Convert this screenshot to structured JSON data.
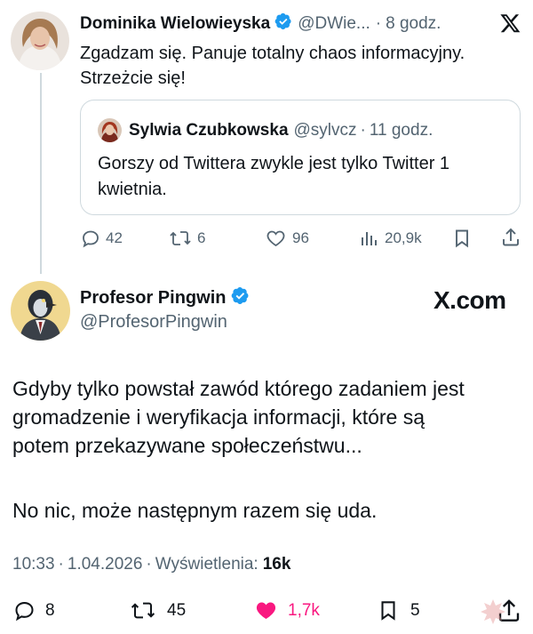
{
  "reply": {
    "name": "Dominika Wielowieyska",
    "handle": "@DWie...",
    "separator": "·",
    "time": "8 godz.",
    "text_line1": "Zgadzam się. Panuje totalny chaos informacyjny.",
    "text_line2": "Strzeżcie się!",
    "quote": {
      "name": "Sylwia Czubkowska",
      "handle": "@sylvcz",
      "separator": "·",
      "time": "11 godz.",
      "text_line1": "Gorszy od Twittera zwykle jest tylko Twitter 1",
      "text_line2": "kwietnia."
    },
    "actions": {
      "replies": "42",
      "reposts": "6",
      "likes": "96",
      "views": "20,9k"
    }
  },
  "main": {
    "name": "Profesor Pingwin",
    "handle": "@ProfesorPingwin",
    "brand": "X.com",
    "text_lines": [
      "Gdyby tylko powstał zawód którego zadaniem jest",
      "gromadzenie i weryfikacja informacji, które są",
      "potem przekazywane społeczeństwu..."
    ],
    "text_line4": "No nic, może następnym razem się uda.",
    "meta": {
      "time": "10:33",
      "sep1": "·",
      "date": "1.04.2026",
      "sep2": "·",
      "views_label": "Wyświetlenia:",
      "views_value": "16k"
    },
    "actions": {
      "replies": "8",
      "reposts": "45",
      "likes": "1,7k",
      "bookmarks": "5"
    }
  },
  "colors": {
    "verified": "#1d9bf0",
    "like_active": "#f91880",
    "muted": "#536471"
  }
}
